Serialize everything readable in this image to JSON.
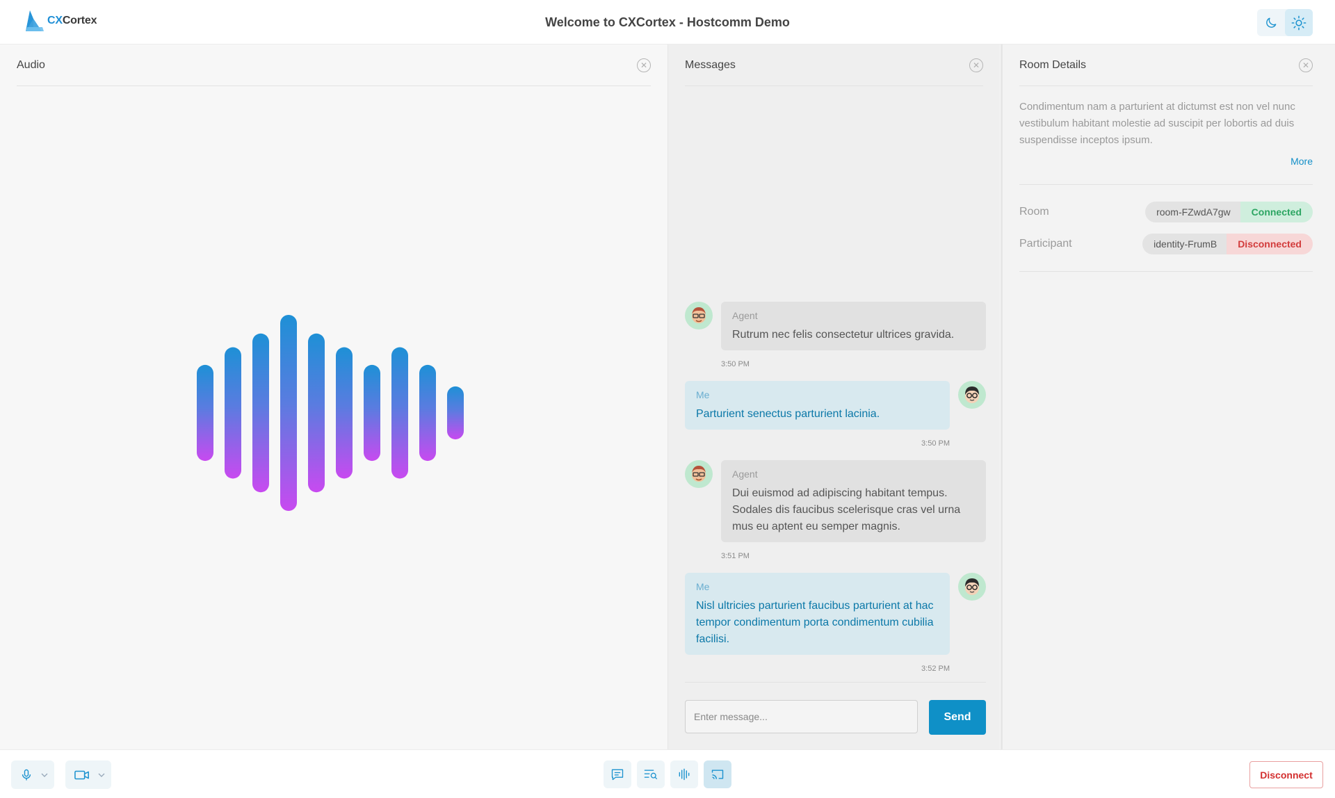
{
  "app": {
    "logo_prefix": "CX",
    "logo_suffix": "Cortex",
    "title": "Welcome to CXCortex - Hostcomm Demo"
  },
  "theme": {
    "dark_icon": "moon-icon",
    "light_icon": "sun-icon",
    "selected": "light"
  },
  "audio_panel": {
    "title": "Audio",
    "close_icon": "close-circle-icon"
  },
  "messages_panel": {
    "title": "Messages",
    "close_icon": "close-circle-icon",
    "messages": [
      {
        "sender": "Agent",
        "text": "Rutrum nec felis consectetur ultrices gravida.",
        "time": "3:50 PM"
      },
      {
        "sender": "Me",
        "text": "Parturient senectus parturient lacinia.",
        "time": "3:50 PM"
      },
      {
        "sender": "Agent",
        "text": "Dui euismod ad adipiscing habitant tempus. Sodales dis faucibus scelerisque cras vel urna mus eu aptent eu semper magnis.",
        "time": "3:51 PM"
      },
      {
        "sender": "Me",
        "text": "Nisl ultricies parturient faucibus parturient at hac tempor condimentum porta condimentum cubilia facilisi.",
        "time": "3:52 PM"
      }
    ],
    "input_placeholder": "Enter message...",
    "input_value": "",
    "send_label": "Send"
  },
  "room_panel": {
    "title": "Room Details",
    "description": "Condimentum nam a parturient at dictumst est non vel nunc vestibulum habitant molestie ad suscipit per lobortis ad duis suspendisse inceptos ipsum.",
    "more_label": "More",
    "room_label": "Room",
    "room_id": "room-FZwdA7gw",
    "room_status": "Connected",
    "participant_label": "Participant",
    "participant_id": "identity-FrumB",
    "participant_status": "Disconnected"
  },
  "bottom_bar": {
    "mic_icon": "microphone-icon",
    "camera_icon": "camera-icon",
    "tools": [
      "chat-icon",
      "transcript-search-icon",
      "audio-wave-icon",
      "screen-cast-icon"
    ],
    "active_tool": "screen-cast-icon",
    "disconnect_label": "Disconnect"
  },
  "colors": {
    "accent": "#0f90c7",
    "connected": "#2ca562",
    "disconnected": "#d23b3b",
    "wave_top": "#1e90d6",
    "wave_bottom": "#c84af0"
  },
  "visualizer": {
    "levels": [
      0.49,
      0.67,
      0.81,
      1.0,
      0.81,
      0.67,
      0.49,
      0.67,
      0.49,
      0.27
    ]
  }
}
